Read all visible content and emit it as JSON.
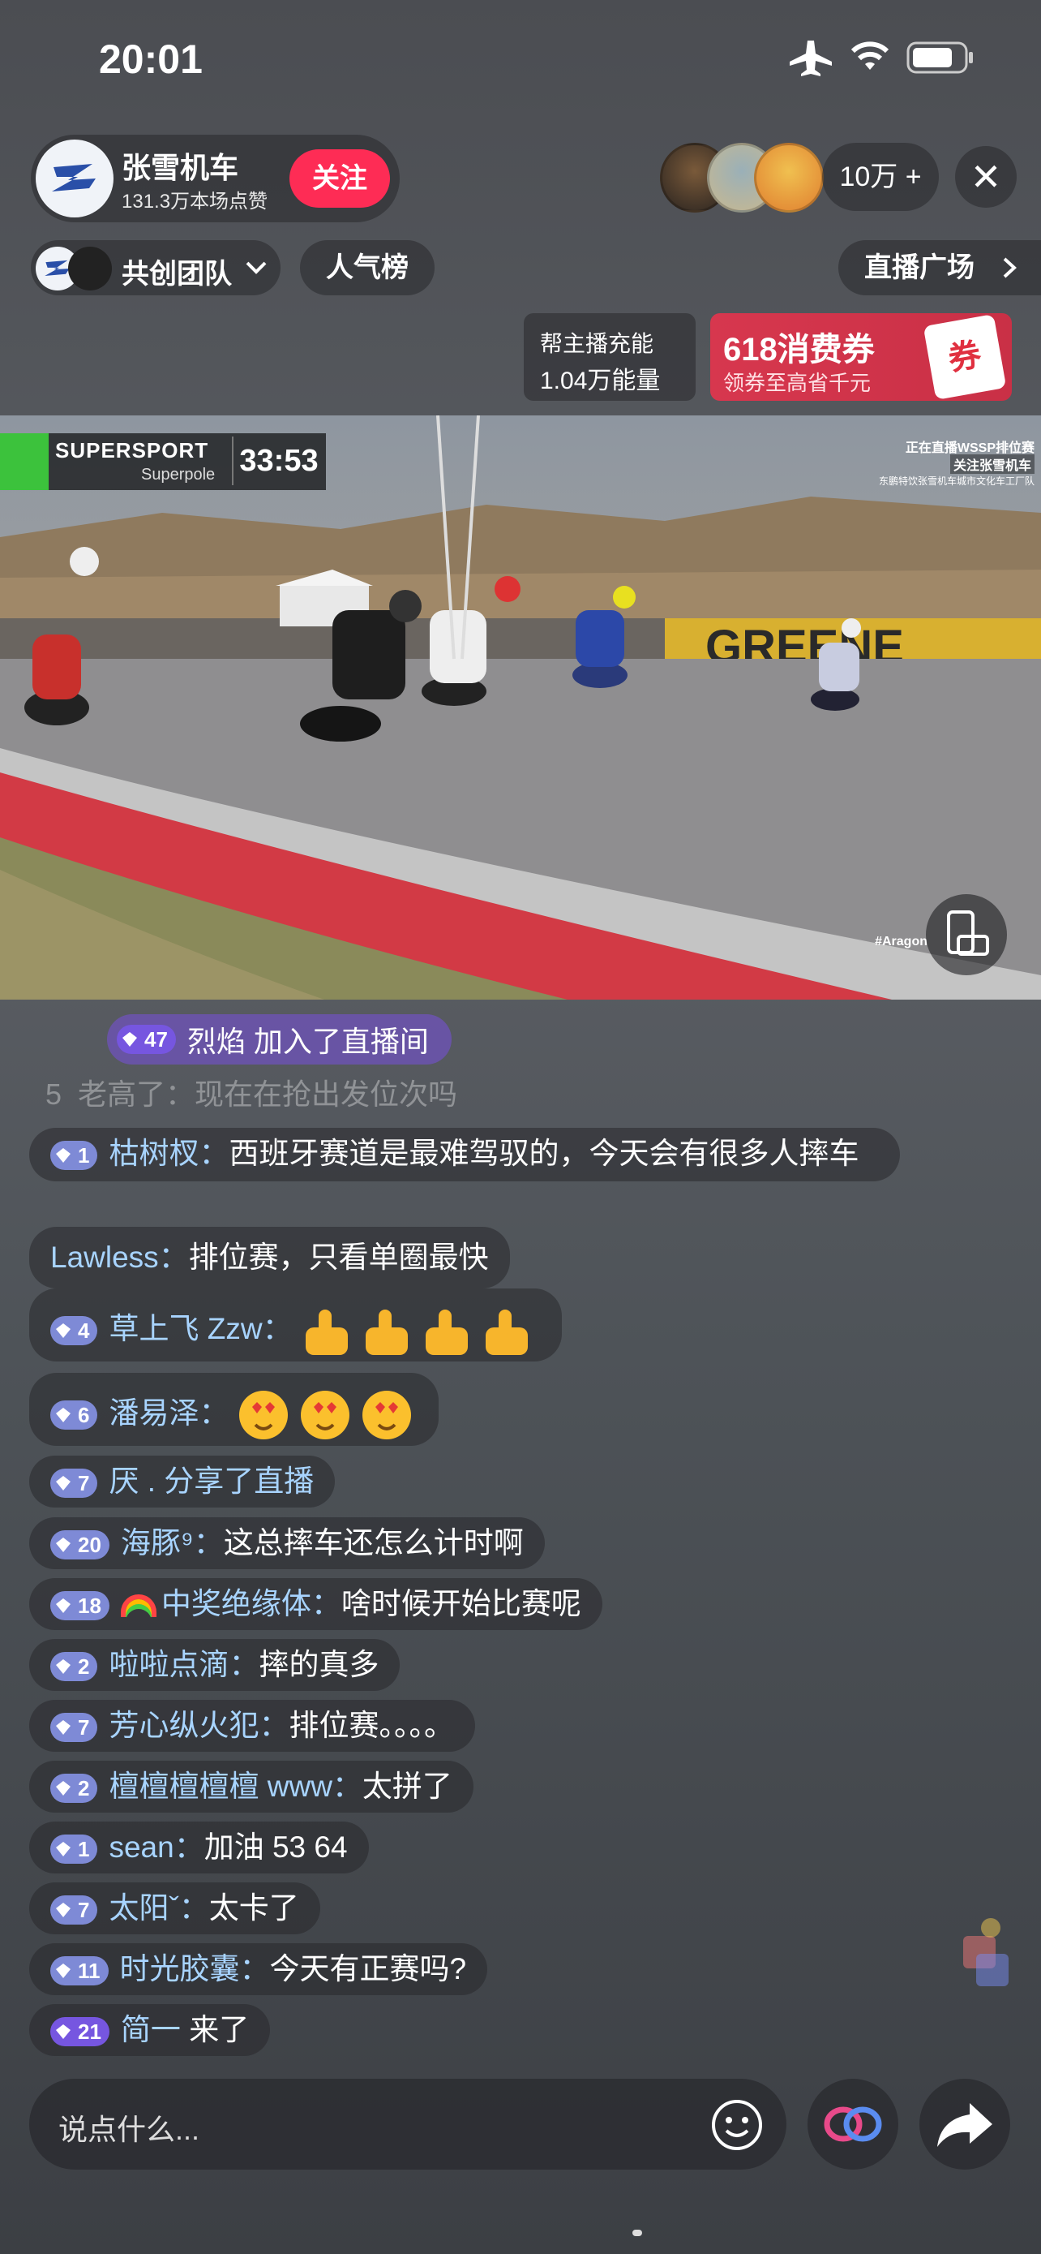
{
  "status": {
    "time": "20:01"
  },
  "host": {
    "name": "张雪机车",
    "likes": "131.3万本场点赞",
    "follow_label": "关注"
  },
  "viewers": {
    "count": "10万 +"
  },
  "team": {
    "label": "共创团队"
  },
  "popularity": {
    "label": "人气榜"
  },
  "plaza": {
    "label": "直播广场"
  },
  "energy": {
    "line1": "帮主播充能",
    "line2": "1.04万能量"
  },
  "coupon": {
    "title": "618消费券",
    "subtitle": "领券至高省千元",
    "tag": "券"
  },
  "video": {
    "series": "SUPERSPORT",
    "session": "Superpole",
    "timer": "33:53",
    "watermark_line1": "正在直播WSSP排位赛",
    "watermark_line2": "关注张雪机车",
    "watermark_line3": "东鹏特饮张雪机车城市文化车工厂队",
    "hashtag": "#Aragon",
    "billboard": "GREENE"
  },
  "join": {
    "level": "47",
    "text": "烈焰 加入了直播间"
  },
  "ghost": {
    "level": "5",
    "text": "老高了：现在在抢出发位次吗"
  },
  "messages": [
    {
      "level": "1",
      "nick": "枯树杈：",
      "text": "西班牙赛道是最难驾驭的，今天会有很多人摔车"
    },
    {
      "level": "",
      "nick": "Lawless：",
      "text": "排位赛，只看单圈最快"
    },
    {
      "level": "4",
      "nick": "草上飞 Zzw：",
      "text": ""
    },
    {
      "level": "6",
      "nick": "潘易泽：",
      "text": ""
    },
    {
      "level": "7",
      "nick": "厌 . 分享了直播",
      "text": ""
    },
    {
      "level": "20",
      "nick": "海豚⁹：",
      "text": "这总摔车还怎么计时啊"
    },
    {
      "level": "18",
      "nick": "中奖绝缘体：",
      "text": "啥时候开始比赛呢"
    },
    {
      "level": "2",
      "nick": "啦啦点滴：",
      "text": "摔的真多"
    },
    {
      "level": "7",
      "nick": "芳心纵火犯：",
      "text": "排位赛。。。。"
    },
    {
      "level": "2",
      "nick": "檀檀檀檀檀 www：",
      "text": "太拼了"
    },
    {
      "level": "1",
      "nick": "sean：",
      "text": "加油 53 64"
    },
    {
      "level": "7",
      "nick": "太阳ˇ：",
      "text": "太卡了"
    },
    {
      "level": "11",
      "nick": "时光胶囊：",
      "text": "今天有正赛吗?"
    },
    {
      "level": "21",
      "nick": "简一",
      "text": " 来了"
    }
  ],
  "input": {
    "placeholder": "说点什么..."
  }
}
